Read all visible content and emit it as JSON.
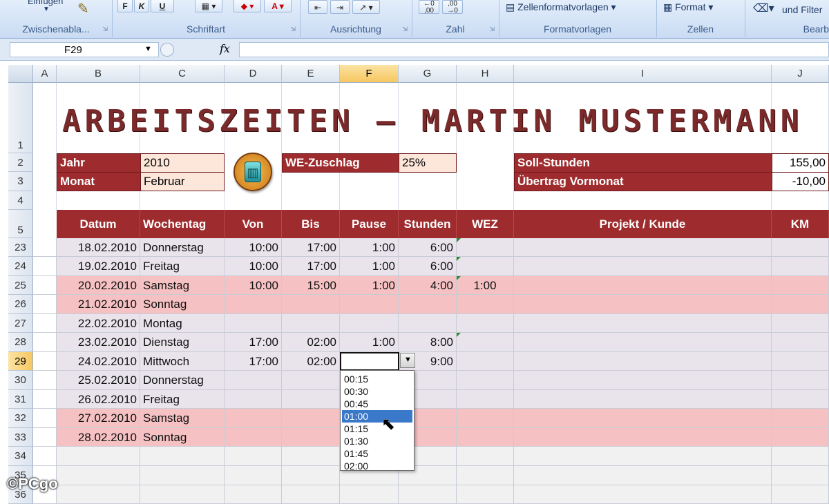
{
  "ribbon": {
    "clipboard": {
      "label": "Zwischenabla...",
      "paste_label": "Einfügen"
    },
    "font": {
      "label": "Schriftart",
      "bold": "F",
      "italic": "K",
      "underline": "U"
    },
    "alignment": {
      "label": "Ausrichtung"
    },
    "number": {
      "label": "Zahl"
    },
    "styles": {
      "label": "Formatvorlagen",
      "cell_styles": "Zellenformatvorlagen"
    },
    "cells": {
      "label": "Zellen",
      "format": "Format"
    },
    "editing": {
      "label": "Bearb",
      "sort_filter": "und Filter"
    }
  },
  "formula_bar": {
    "name_box": "F29",
    "fx": "fx",
    "value": ""
  },
  "columns": [
    "A",
    "B",
    "C",
    "D",
    "E",
    "F",
    "G",
    "H",
    "I",
    "J"
  ],
  "selected_column": "F",
  "selected_row": "29",
  "title": "ARBEITSZEITEN – MARTIN MUSTERMANN",
  "info": {
    "jahr_label": "Jahr",
    "jahr_value": "2010",
    "monat_label": "Monat",
    "monat_value": "Februar",
    "we_label": "WE-Zuschlag",
    "we_value": "25%",
    "soll_label": "Soll-Stunden",
    "soll_value": "155,00",
    "uebertrag_label": "Übertrag Vormonat",
    "uebertrag_value": "-10,00"
  },
  "table": {
    "headers": [
      "Datum",
      "Wochentag",
      "Von",
      "Bis",
      "Pause",
      "Stunden",
      "WEZ",
      "Projekt / Kunde",
      "KM"
    ],
    "rows": [
      {
        "row": "23",
        "datum": "18.02.2010",
        "tag": "Donnerstag",
        "von": "10:00",
        "bis": "17:00",
        "pause": "1:00",
        "stunden": "6:00",
        "wez": "",
        "type": "wk"
      },
      {
        "row": "24",
        "datum": "19.02.2010",
        "tag": "Freitag",
        "von": "10:00",
        "bis": "17:00",
        "pause": "1:00",
        "stunden": "6:00",
        "wez": "",
        "type": "wk"
      },
      {
        "row": "25",
        "datum": "20.02.2010",
        "tag": "Samstag",
        "von": "10:00",
        "bis": "15:00",
        "pause": "1:00",
        "stunden": "4:00",
        "wez": "1:00",
        "type": "we"
      },
      {
        "row": "26",
        "datum": "21.02.2010",
        "tag": "Sonntag",
        "von": "",
        "bis": "",
        "pause": "",
        "stunden": "",
        "wez": "",
        "type": "we"
      },
      {
        "row": "27",
        "datum": "22.02.2010",
        "tag": "Montag",
        "von": "",
        "bis": "",
        "pause": "",
        "stunden": "",
        "wez": "",
        "type": "wk"
      },
      {
        "row": "28",
        "datum": "23.02.2010",
        "tag": "Dienstag",
        "von": "17:00",
        "bis": "02:00",
        "pause": "1:00",
        "stunden": "8:00",
        "wez": "",
        "type": "wk"
      },
      {
        "row": "29",
        "datum": "24.02.2010",
        "tag": "Mittwoch",
        "von": "17:00",
        "bis": "02:00",
        "pause": "",
        "stunden": "9:00",
        "wez": "",
        "type": "wk"
      },
      {
        "row": "30",
        "datum": "25.02.2010",
        "tag": "Donnerstag",
        "von": "",
        "bis": "",
        "pause": "",
        "stunden": "",
        "wez": "",
        "type": "wk"
      },
      {
        "row": "31",
        "datum": "26.02.2010",
        "tag": "Freitag",
        "von": "",
        "bis": "",
        "pause": "",
        "stunden": "",
        "wez": "",
        "type": "wk"
      },
      {
        "row": "32",
        "datum": "27.02.2010",
        "tag": "Samstag",
        "von": "",
        "bis": "",
        "pause": "",
        "stunden": "",
        "wez": "",
        "type": "we"
      },
      {
        "row": "33",
        "datum": "28.02.2010",
        "tag": "Sonntag",
        "von": "",
        "bis": "",
        "pause": "",
        "stunden": "",
        "wez": "",
        "type": "we"
      },
      {
        "row": "34",
        "datum": "",
        "tag": "",
        "von": "",
        "bis": "",
        "pause": "",
        "stunden": "",
        "wez": "",
        "type": "empty"
      },
      {
        "row": "35",
        "datum": "",
        "tag": "",
        "von": "",
        "bis": "",
        "pause": "",
        "stunden": "",
        "wez": "",
        "type": "empty"
      },
      {
        "row": "36",
        "datum": "",
        "tag": "",
        "von": "",
        "bis": "",
        "pause": "",
        "stunden": "",
        "wez": "",
        "type": "empty"
      }
    ]
  },
  "dropdown": {
    "options": [
      "00:15",
      "00:30",
      "00:45",
      "01:00",
      "01:15",
      "01:30",
      "01:45",
      "02:00"
    ],
    "highlighted": "01:00"
  },
  "watermark": "©PCgo",
  "colors": {
    "accent": "#9e2c2e",
    "weekend": "#f6c1c3",
    "weekday": "#e9e3ec"
  }
}
